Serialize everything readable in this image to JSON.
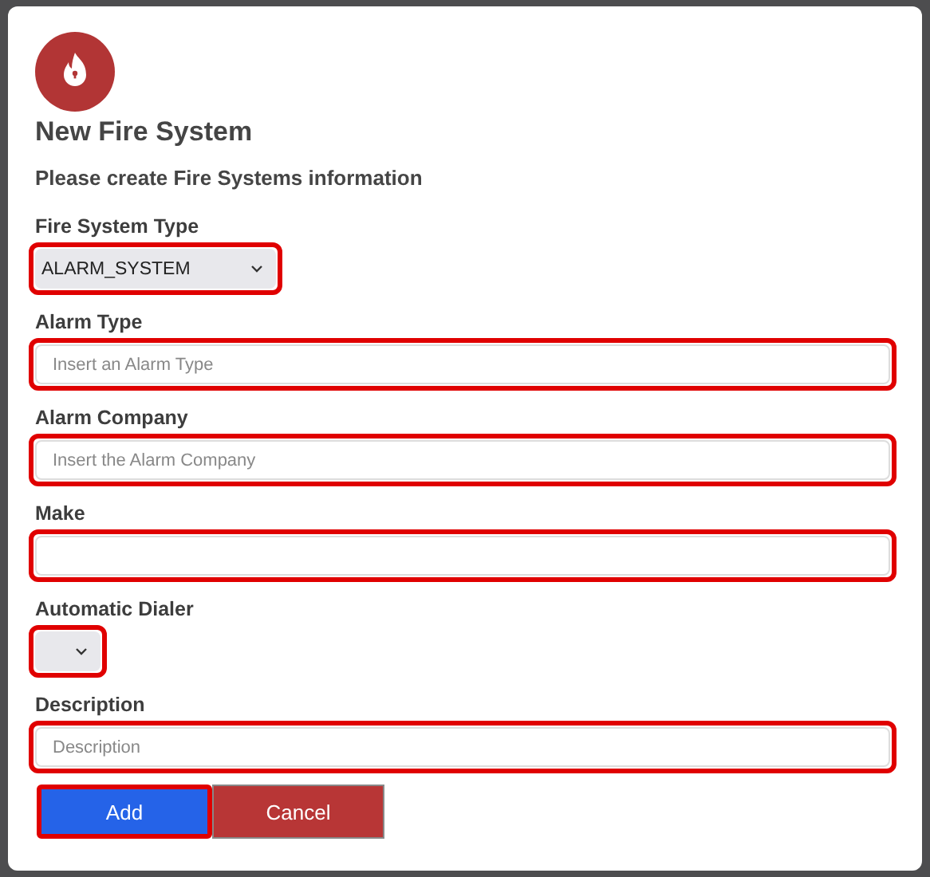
{
  "dialog": {
    "title": "New Fire System",
    "subtitle": "Please create Fire Systems information"
  },
  "fields": [
    {
      "label": "Fire System Type",
      "kind": "select",
      "value": "ALARM_SYSTEM",
      "highlighted": true
    },
    {
      "label": "Alarm Type",
      "kind": "text",
      "placeholder": "Insert an Alarm Type",
      "highlighted": true
    },
    {
      "label": "Alarm Company",
      "kind": "text",
      "placeholder": "Insert the Alarm Company",
      "highlighted": true
    },
    {
      "label": "Make",
      "kind": "text",
      "highlighted": true
    },
    {
      "label": "Automatic Dialer",
      "kind": "select",
      "highlighted": true
    },
    {
      "label": "Description",
      "kind": "text",
      "placeholder": "Description",
      "highlighted": true
    }
  ],
  "buttons": [
    {
      "label": "Add",
      "kind": "primary",
      "highlighted": true
    },
    {
      "label": "Cancel",
      "kind": "danger",
      "highlighted": false
    }
  ]
}
